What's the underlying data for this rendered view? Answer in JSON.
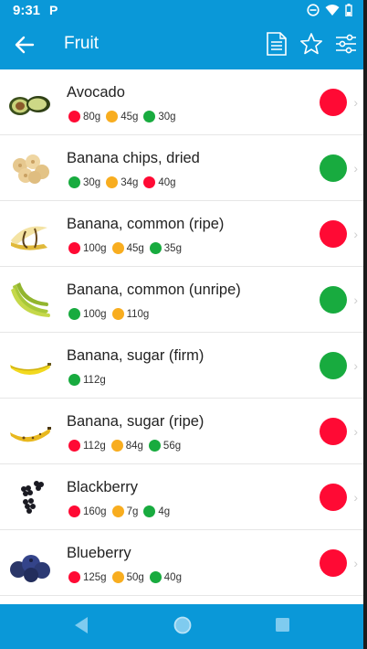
{
  "status": {
    "time": "9:31",
    "notif": "P"
  },
  "appbar": {
    "title": "Fruit"
  },
  "colors": {
    "red": "#ff0a34",
    "amber": "#f8ad1f",
    "green": "#18ab3f",
    "primary": "#0a98d8"
  },
  "items": [
    {
      "name": "Avocado",
      "image": "avocado",
      "rating": "red",
      "values": [
        {
          "color": "red",
          "text": "80g"
        },
        {
          "color": "amber",
          "text": "45g"
        },
        {
          "color": "green",
          "text": "30g"
        }
      ]
    },
    {
      "name": "Banana chips, dried",
      "image": "banana-chips",
      "rating": "green",
      "values": [
        {
          "color": "green",
          "text": "30g"
        },
        {
          "color": "amber",
          "text": "34g"
        },
        {
          "color": "red",
          "text": "40g"
        }
      ]
    },
    {
      "name": "Banana, common (ripe)",
      "image": "banana-ripe-peeled",
      "rating": "red",
      "values": [
        {
          "color": "red",
          "text": "100g"
        },
        {
          "color": "amber",
          "text": "45g"
        },
        {
          "color": "green",
          "text": "35g"
        }
      ]
    },
    {
      "name": "Banana, common (unripe)",
      "image": "banana-bunch-unripe",
      "rating": "green",
      "values": [
        {
          "color": "green",
          "text": "100g"
        },
        {
          "color": "amber",
          "text": "110g"
        }
      ]
    },
    {
      "name": "Banana, sugar (firm)",
      "image": "banana-sugar-firm",
      "rating": "green",
      "values": [
        {
          "color": "green",
          "text": "112g"
        }
      ]
    },
    {
      "name": "Banana, sugar (ripe)",
      "image": "banana-sugar-ripe",
      "rating": "red",
      "values": [
        {
          "color": "red",
          "text": "112g"
        },
        {
          "color": "amber",
          "text": "84g"
        },
        {
          "color": "green",
          "text": "56g"
        }
      ]
    },
    {
      "name": "Blackberry",
      "image": "blackberry",
      "rating": "red",
      "values": [
        {
          "color": "red",
          "text": "160g"
        },
        {
          "color": "amber",
          "text": "7g"
        },
        {
          "color": "green",
          "text": "4g"
        }
      ]
    },
    {
      "name": "Blueberry",
      "image": "blueberry",
      "rating": "red",
      "values": [
        {
          "color": "red",
          "text": "125g"
        },
        {
          "color": "amber",
          "text": "50g"
        },
        {
          "color": "green",
          "text": "40g"
        }
      ]
    }
  ]
}
